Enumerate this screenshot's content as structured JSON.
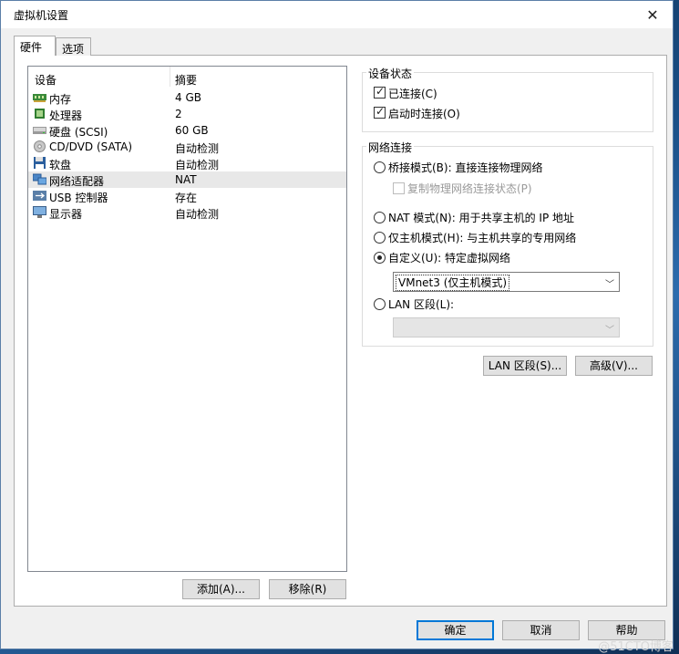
{
  "window": {
    "title": "虚拟机设置",
    "close_glyph": "✕"
  },
  "tabs": [
    {
      "label": "硬件",
      "active": true
    },
    {
      "label": "选项",
      "active": false
    }
  ],
  "device_list": {
    "columns": {
      "device": "设备",
      "summary": "摘要"
    },
    "items": [
      {
        "name": "内存",
        "value": "4 GB",
        "icon": "memory-icon"
      },
      {
        "name": "处理器",
        "value": "2",
        "icon": "processor-icon"
      },
      {
        "name": "硬盘 (SCSI)",
        "value": "60 GB",
        "icon": "hard-disk-icon"
      },
      {
        "name": "CD/DVD (SATA)",
        "value": "自动检测",
        "icon": "cd-dvd-icon"
      },
      {
        "name": "软盘",
        "value": "自动检测",
        "icon": "floppy-icon"
      },
      {
        "name": "网络适配器",
        "value": "NAT",
        "icon": "network-adapter-icon",
        "selected": true
      },
      {
        "name": "USB 控制器",
        "value": "存在",
        "icon": "usb-icon"
      },
      {
        "name": "显示器",
        "value": "自动检测",
        "icon": "display-icon"
      }
    ]
  },
  "list_buttons": {
    "add": "添加(A)...",
    "remove": "移除(R)"
  },
  "device_status": {
    "title": "设备状态",
    "connected": {
      "label": "已连接(C)",
      "checked": true
    },
    "connect_at_power_on": {
      "label": "启动时连接(O)",
      "checked": true
    }
  },
  "network_connection": {
    "title": "网络连接",
    "bridged": {
      "label": "桥接模式(B): 直接连接物理网络",
      "checked": false
    },
    "replicate": {
      "label": "复制物理网络连接状态(P)",
      "checked": false,
      "disabled": true
    },
    "nat": {
      "label": "NAT 模式(N): 用于共享主机的 IP 地址",
      "checked": false
    },
    "host_only": {
      "label": "仅主机模式(H): 与主机共享的专用网络",
      "checked": false
    },
    "custom": {
      "label": "自定义(U): 特定虚拟网络",
      "checked": true
    },
    "custom_select": {
      "value": "VMnet3 (仅主机模式)"
    },
    "lan_segment": {
      "label": "LAN 区段(L):",
      "checked": false
    },
    "lan_select": {
      "value": ""
    }
  },
  "panel_buttons": {
    "lan_segments": "LAN 区段(S)...",
    "advanced": "高级(V)..."
  },
  "footer_buttons": {
    "ok": "确定",
    "cancel": "取消",
    "help": "帮助"
  },
  "watermark": "@51CTO博客"
}
